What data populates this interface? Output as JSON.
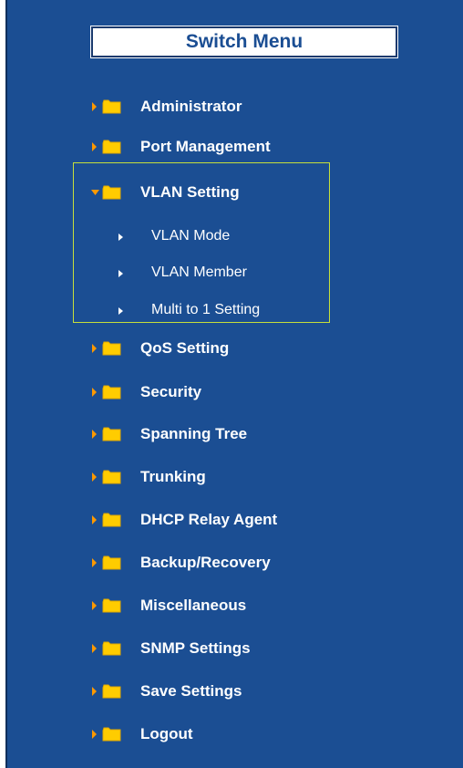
{
  "title": "Switch Menu",
  "items": [
    {
      "label": "Administrator"
    },
    {
      "label": "Port Management"
    },
    {
      "label": "VLAN Setting"
    },
    {
      "label": "QoS Setting"
    },
    {
      "label": "Security"
    },
    {
      "label": "Spanning Tree"
    },
    {
      "label": "Trunking"
    },
    {
      "label": "DHCP Relay Agent"
    },
    {
      "label": "Backup/Recovery"
    },
    {
      "label": "Miscellaneous"
    },
    {
      "label": "SNMP Settings"
    },
    {
      "label": "Save Settings"
    },
    {
      "label": "Logout"
    }
  ],
  "vlan_sub": [
    {
      "label": "VLAN Mode"
    },
    {
      "label": "VLAN Member"
    },
    {
      "label": "Multi to 1 Setting"
    }
  ],
  "colors": {
    "background": "#1b4e93",
    "folder": "#ffcc00",
    "arrow": "#ff9900",
    "highlight_border": "#c6df3b",
    "text": "#ffffff"
  },
  "icons": {
    "collapsed": "arrow-right-icon",
    "expanded": "arrow-down-icon",
    "folder": "folder-icon",
    "bullet": "triangle-bullet-icon"
  }
}
